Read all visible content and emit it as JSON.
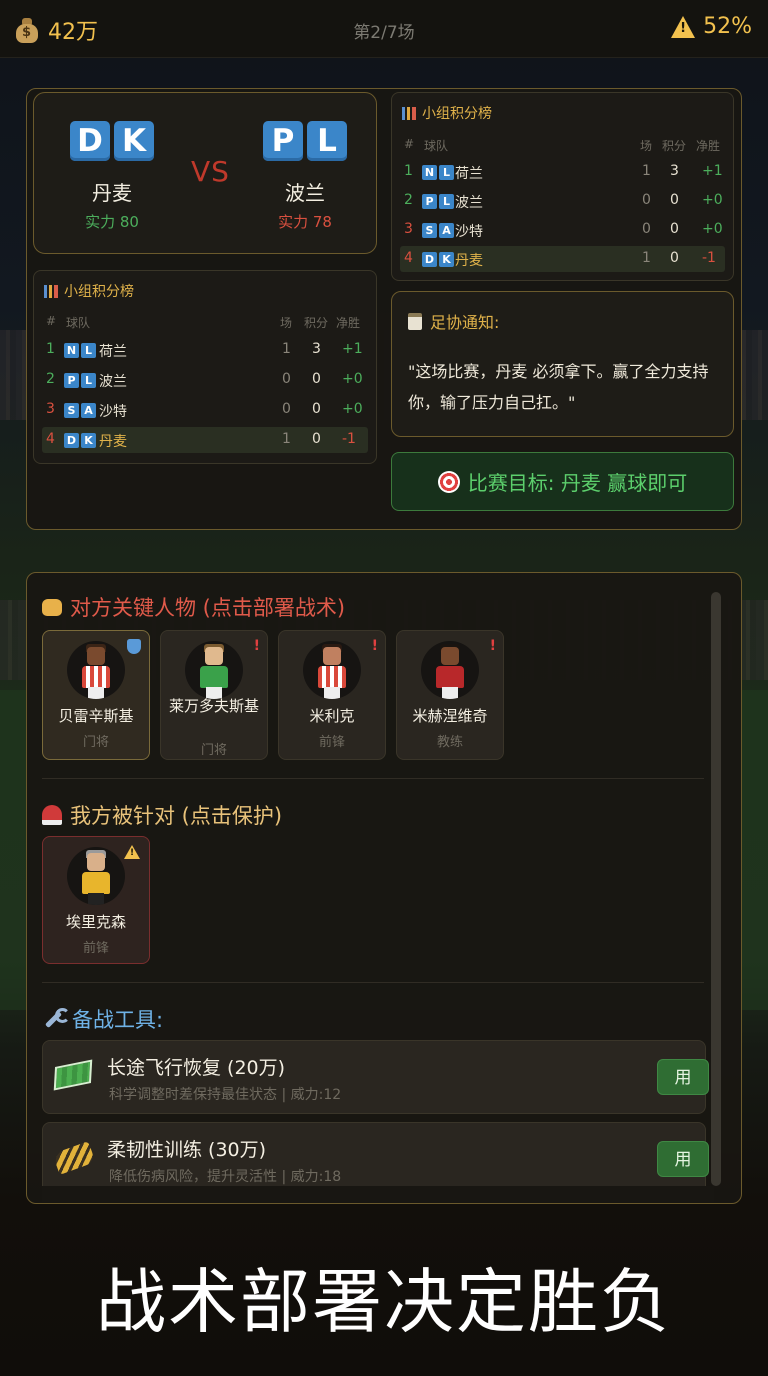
{
  "topbar": {
    "money_icon": "money-bag-icon",
    "money": "42万",
    "round": "第2/7场",
    "risk_icon": "warning-icon",
    "risk": "52%"
  },
  "match": {
    "home": {
      "code": [
        "D",
        "K"
      ],
      "name": "丹麦",
      "power": "实力 80",
      "power_color": "#4cae5c"
    },
    "vs": "VS",
    "away": {
      "code": [
        "P",
        "L"
      ],
      "name": "波兰",
      "power": "实力 78",
      "power_color": "#d9503f"
    }
  },
  "standings": {
    "title": "小组积分榜",
    "headers": {
      "rank": "#",
      "team": "球队",
      "played": "场",
      "points": "积分",
      "gd": "净胜"
    },
    "rows": [
      {
        "rank": "1",
        "code": [
          "N",
          "L"
        ],
        "team": "荷兰",
        "played": "1",
        "points": "3",
        "gd": "+1"
      },
      {
        "rank": "2",
        "code": [
          "P",
          "L"
        ],
        "team": "波兰",
        "played": "0",
        "points": "0",
        "gd": "+0"
      },
      {
        "rank": "3",
        "code": [
          "S",
          "A"
        ],
        "team": "沙特",
        "played": "0",
        "points": "0",
        "gd": "+0"
      },
      {
        "rank": "4",
        "code": [
          "D",
          "K"
        ],
        "team": "丹麦",
        "played": "1",
        "points": "0",
        "gd": "-1"
      }
    ]
  },
  "notice": {
    "title": "足协通知:",
    "text": "\"这场比赛，丹麦 必须拿下。赢了全力支持你，输了压力自己扛。\""
  },
  "goal": {
    "text": "比赛目标: 丹麦 赢球即可",
    "icon": "target-icon"
  },
  "opponents": {
    "title": "对方关键人物 (点击部署战术)",
    "icon": "fist-icon",
    "players": [
      {
        "name": "贝雷辛斯基",
        "role": "门将",
        "status": "shield"
      },
      {
        "name": "莱万多夫斯基",
        "role": "门将",
        "status": "alert"
      },
      {
        "name": "米利克",
        "role": "前锋",
        "status": "alert"
      },
      {
        "name": "米赫涅维奇",
        "role": "教练",
        "status": "alert"
      }
    ],
    "alert_mark": "!"
  },
  "targeted": {
    "title": "我方被针对 (点击保护)",
    "icon": "siren-icon",
    "players": [
      {
        "name": "埃里克森",
        "role": "前锋",
        "status": "warning"
      }
    ]
  },
  "tools": {
    "title": "备战工具:",
    "icon": "wrench-icon",
    "items": [
      {
        "name": "长途飞行恢复 (20万)",
        "desc": "科学调整时差保持最佳状态 | 威力:12",
        "button": "用",
        "icon": "pitch-icon"
      },
      {
        "name": "柔韧性训练 (30万)",
        "desc": "降低伤病风险，提升灵活性 | 威力:18",
        "button": "用",
        "icon": "boot-icon"
      }
    ]
  },
  "caption": "战术部署决定胜负"
}
